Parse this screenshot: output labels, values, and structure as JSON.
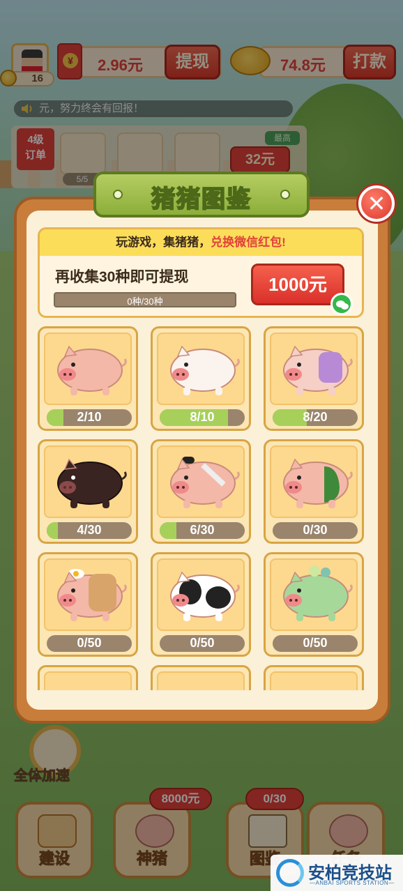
{
  "hud": {
    "level": "16",
    "cash_value": "2.96元",
    "withdraw_label": "提现",
    "bank_value": "74.8元",
    "pay_label": "打款",
    "marquee_text": "元，努力终会有回报！",
    "order_tag": "4级\n订单",
    "order_count": "5/5",
    "top_badge": "最高",
    "order_price": "32元"
  },
  "modal": {
    "title": "猪猪图鉴",
    "banner_prefix": "玩游戏，集猪猪，",
    "banner_highlight": "兑换微信红包!",
    "collect_text": "再收集30种即可提现",
    "collect_progress_text": "0种/30种",
    "collect_progress": 0.0,
    "reward_label": "1000元"
  },
  "pigs": [
    {
      "progress_text": "2/10",
      "progress": 0.2,
      "icon": "pink-pig-icon",
      "color": "#f4b8a8"
    },
    {
      "progress_text": "8/10",
      "progress": 0.8,
      "icon": "white-pig-icon",
      "color": "#fbf4ee"
    },
    {
      "progress_text": "8/20",
      "progress": 0.4,
      "icon": "baby-pig-icon",
      "color": "#f6cfc6"
    },
    {
      "progress_text": "4/30",
      "progress": 0.13,
      "icon": "black-pig-icon",
      "color": "#3a2422"
    },
    {
      "progress_text": "6/30",
      "progress": 0.2,
      "icon": "sumo-pig-icon",
      "color": "#f4b8a8"
    },
    {
      "progress_text": "0/30",
      "progress": 0.0,
      "icon": "watermelon-pig-icon",
      "color": "#f4b8a8"
    },
    {
      "progress_text": "0/50",
      "progress": 0.0,
      "icon": "toast-pig-icon",
      "color": "#f4b8a8"
    },
    {
      "progress_text": "0/50",
      "progress": 0.0,
      "icon": "panda-pig-icon",
      "color": "#ffffff"
    },
    {
      "progress_text": "0/50",
      "progress": 0.0,
      "icon": "green-pig-icon",
      "color": "#a6d89a"
    }
  ],
  "bottom": {
    "speedup_label": "全体加速",
    "build_label": "建设",
    "god_pig_label": "神猪",
    "god_pig_bubble": "8000元",
    "collection_label": "图鉴",
    "collection_bubble": "0/30",
    "task_label": "任务"
  },
  "watermark": {
    "title": "安柏竞技站",
    "subtitle": "—ANBAI SPORTS STATION—"
  }
}
